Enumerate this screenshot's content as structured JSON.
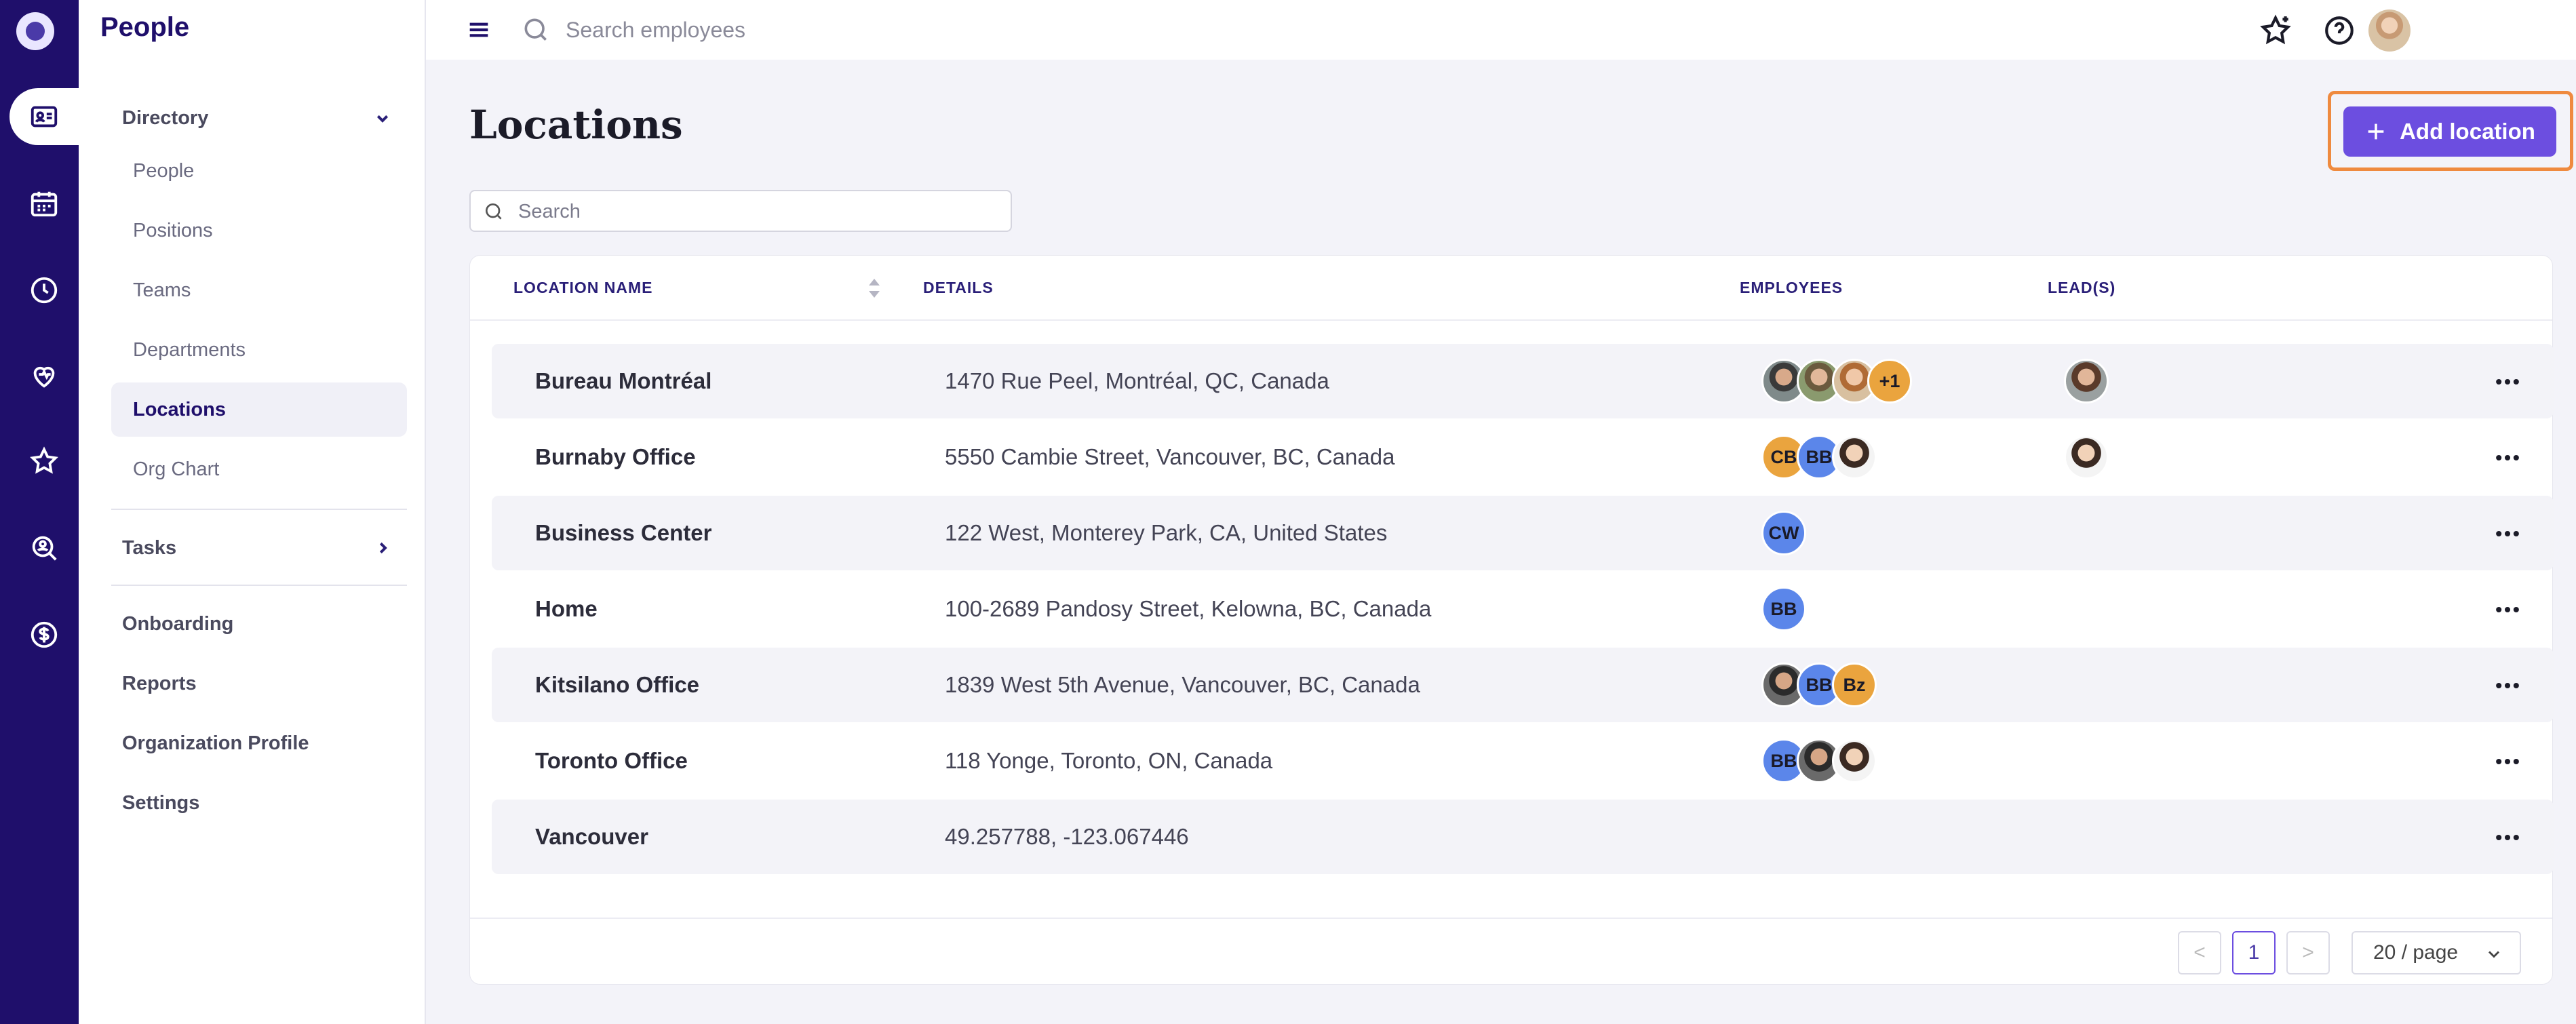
{
  "app": {
    "name": "People"
  },
  "topbar": {
    "search_placeholder": "Search employees"
  },
  "sidebar": {
    "directory": {
      "label": "Directory",
      "items": [
        "People",
        "Positions",
        "Teams",
        "Departments",
        "Locations",
        "Org Chart"
      ],
      "active": "Locations"
    },
    "tasks": "Tasks",
    "links": [
      "Onboarding",
      "Reports",
      "Organization Profile",
      "Settings"
    ]
  },
  "main": {
    "title": "Locations",
    "add_button": "Add location",
    "search_placeholder": "Search",
    "columns": [
      "LOCATION NAME",
      "DETAILS",
      "EMPLOYEES",
      "LEAD(S)"
    ],
    "rows": [
      {
        "name": "Bureau Montréal",
        "details": "1470 Rue Peel, Montréal, QC, Canada",
        "employees": [
          "photo",
          "photo",
          "photo",
          "+1"
        ],
        "leads": [
          "photo"
        ]
      },
      {
        "name": "Burnaby Office",
        "details": "5550 Cambie Street, Vancouver, BC, Canada",
        "employees": [
          "CB",
          "BB",
          "photo"
        ],
        "leads": [
          "photo"
        ]
      },
      {
        "name": "Business Center",
        "details": "122 West, Monterey Park, CA, United States",
        "employees": [
          "CW"
        ],
        "leads": []
      },
      {
        "name": "Home",
        "details": "100-2689 Pandosy Street, Kelowna, BC, Canada",
        "employees": [
          "BB"
        ],
        "leads": []
      },
      {
        "name": "Kitsilano Office",
        "details": "1839 West 5th Avenue, Vancouver, BC, Canada",
        "employees": [
          "photo",
          "BB",
          "Bz"
        ],
        "leads": []
      },
      {
        "name": "Toronto Office",
        "details": "118 Yonge, Toronto, ON, Canada",
        "employees": [
          "BB",
          "photo",
          "photo"
        ],
        "leads": []
      },
      {
        "name": "Vancouver",
        "details": "49.257788, -123.067446",
        "employees": [],
        "leads": []
      }
    ],
    "pagination": {
      "current_page": "1",
      "page_size": "20 / page",
      "prev": "<",
      "next": ">"
    }
  },
  "colors": {
    "rail": "#1f0f6b",
    "accent": "#6c4ee0",
    "highlight": "#ef8a3f"
  }
}
